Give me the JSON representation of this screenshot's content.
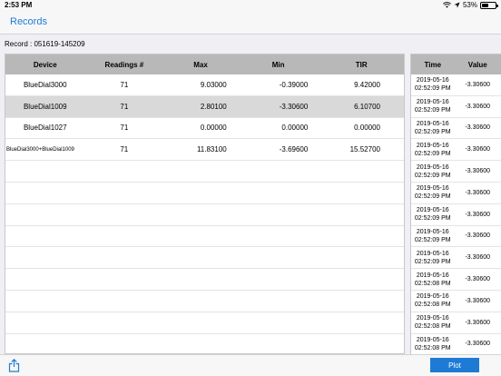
{
  "status_bar": {
    "time": "2:53 PM",
    "battery": "53%"
  },
  "nav": {
    "back_label": "Records"
  },
  "record": {
    "label": "Record : 051619-145209"
  },
  "main_table": {
    "columns": [
      "Device",
      "Readings #",
      "Max",
      "Min",
      "TIR"
    ],
    "rows": [
      [
        "BlueDial3000",
        "71",
        "9.03000",
        "-0.39000",
        "9.42000"
      ],
      [
        "BlueDial1009",
        "71",
        "2.80100",
        "-3.30600",
        "6.10700"
      ],
      [
        "BlueDial1027",
        "71",
        "0.00000",
        "0.00000",
        "0.00000"
      ],
      [
        "BlueDial3000+BlueDial1009",
        "71",
        "11.83100",
        "-3.69600",
        "15.52700"
      ]
    ],
    "selected_row": 1
  },
  "side_table": {
    "columns": [
      "Time",
      "Value"
    ],
    "rows": [
      [
        "2019-05-16",
        "02:52:09 PM",
        "-3.30600"
      ],
      [
        "2019-05-16",
        "02:52:09 PM",
        "-3.30600"
      ],
      [
        "2019-05-16",
        "02:52:09 PM",
        "-3.30600"
      ],
      [
        "2019-05-16",
        "02:52:09 PM",
        "-3.30600"
      ],
      [
        "2019-05-16",
        "02:52:09 PM",
        "-3.30600"
      ],
      [
        "2019-05-16",
        "02:52:09 PM",
        "-3.30600"
      ],
      [
        "2019-05-16",
        "02:52:09 PM",
        "-3.30600"
      ],
      [
        "2019-05-16",
        "02:52:09 PM",
        "-3.30600"
      ],
      [
        "2019-05-16",
        "02:52:09 PM",
        "-3.30600"
      ],
      [
        "2019-05-16",
        "02:52:08 PM",
        "-3.30600"
      ],
      [
        "2019-05-16",
        "02:52:08 PM",
        "-3.30600"
      ],
      [
        "2019-05-16",
        "02:52:08 PM",
        "-3.30600"
      ],
      [
        "2019-05-16",
        "02:52:08 PM",
        "-3.30600"
      ]
    ]
  },
  "toolbar": {
    "plot_label": "Plot"
  },
  "icons": {
    "wifi": "wifi-icon",
    "location": "location-arrow-icon",
    "battery": "battery-icon",
    "share": "share-icon"
  },
  "colors": {
    "accent": "#1d7bd6",
    "header_bg": "#b8b8b8",
    "selected_bg": "#d9d9d9"
  }
}
